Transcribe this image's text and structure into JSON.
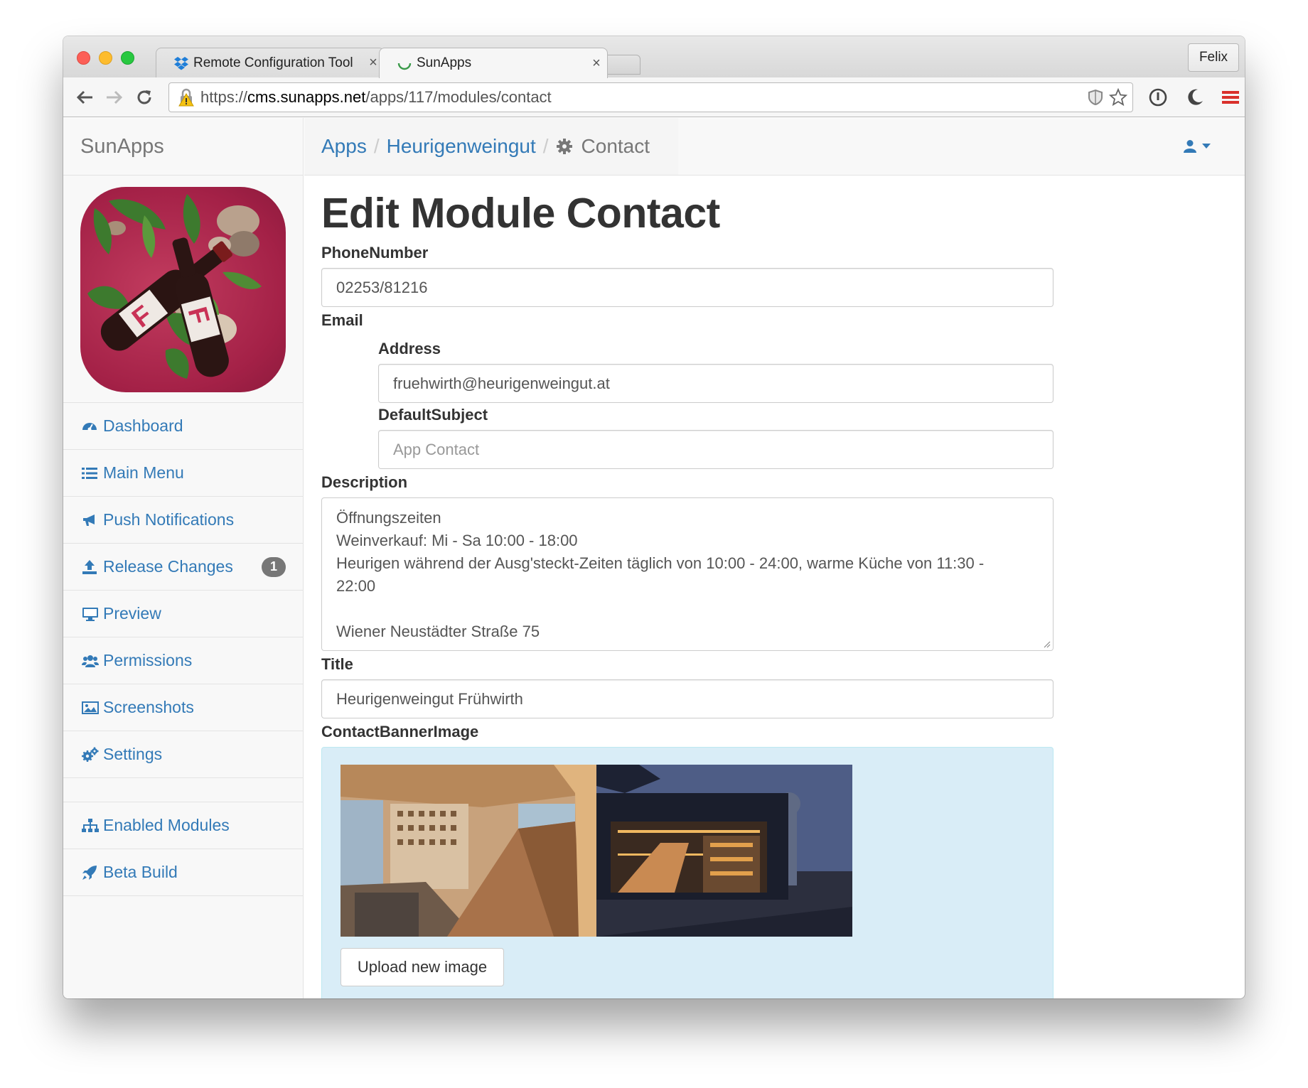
{
  "browser": {
    "tabs": [
      {
        "title": "Remote Configuration Tool",
        "close": "×"
      },
      {
        "title": "SunApps",
        "close": "×"
      }
    ],
    "profile": "Felix",
    "url": {
      "scheme": "https://",
      "host": "cms.sunapps.net",
      "path": "/apps/117/modules/contact"
    }
  },
  "sidebar": {
    "brand": "SunApps",
    "items": [
      {
        "label": "Dashboard",
        "icon": "dashboard-icon"
      },
      {
        "label": "Main Menu",
        "icon": "list-icon"
      },
      {
        "label": "Push Notifications",
        "icon": "bullhorn-icon"
      },
      {
        "label": "Release Changes",
        "icon": "upload-icon",
        "badge": "1"
      },
      {
        "label": "Preview",
        "icon": "desktop-icon"
      },
      {
        "label": "Permissions",
        "icon": "users-icon"
      },
      {
        "label": "Screenshots",
        "icon": "picture-icon"
      },
      {
        "label": "Settings",
        "icon": "cogs-icon"
      }
    ],
    "items2": [
      {
        "label": "Enabled Modules",
        "icon": "sitemap-icon"
      },
      {
        "label": "Beta Build",
        "icon": "rocket-icon"
      }
    ]
  },
  "breadcrumb": {
    "apps": "Apps",
    "app": "Heurigenweingut",
    "current": "Contact",
    "sep": "/"
  },
  "page": {
    "title": "Edit Module Contact",
    "phone_label": "PhoneNumber",
    "phone_value": "02253/81216",
    "email_label": "Email",
    "address_label": "Address",
    "address_value": "fruehwirth@heurigenweingut.at",
    "subject_label": "DefaultSubject",
    "subject_placeholder": "App Contact",
    "description_label": "Description",
    "description_lines": [
      "Öffnungszeiten",
      "Weinverkauf: Mi - Sa 10:00 - 18:00",
      "Heurigen während der Ausg'steckt-Zeiten täglich von 10:00 - 24:00, warme Küche von 11:30 -",
      "22:00",
      "",
      "Wiener Neustädter Straße 75"
    ],
    "title_label": "Title",
    "title_value": "Heurigenweingut Frühwirth",
    "banner_label": "ContactBannerImage",
    "upload_label": "Upload new image"
  },
  "colors": {
    "link": "#337ab7",
    "badge": "#777777",
    "banner_bg": "#d9edf7"
  }
}
